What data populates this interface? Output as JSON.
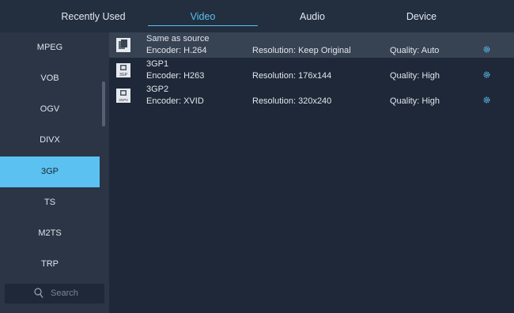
{
  "tabs": [
    {
      "label": "Recently Used",
      "active": false
    },
    {
      "label": "Video",
      "active": true
    },
    {
      "label": "Audio",
      "active": false
    },
    {
      "label": "Device",
      "active": false
    }
  ],
  "sidebar": {
    "items": [
      {
        "label": "MPEG",
        "selected": false
      },
      {
        "label": "VOB",
        "selected": false
      },
      {
        "label": "OGV",
        "selected": false
      },
      {
        "label": "DIVX",
        "selected": false
      },
      {
        "label": "3GP",
        "selected": true
      },
      {
        "label": "TS",
        "selected": false
      },
      {
        "label": "M2TS",
        "selected": false
      },
      {
        "label": "TRP",
        "selected": false
      }
    ],
    "search_placeholder": "Search"
  },
  "presets": [
    {
      "name": "Same as source",
      "encoder": "Encoder: H.264",
      "resolution": "Resolution: Keep Original",
      "quality": "Quality: Auto",
      "icon": "copy-source-icon",
      "thumb_label": ""
    },
    {
      "name": "3GP1",
      "encoder": "Encoder: H263",
      "resolution": "Resolution: 176x144",
      "quality": "Quality: High",
      "icon": "3gp-file-icon",
      "thumb_label": "3GP"
    },
    {
      "name": "3GP2",
      "encoder": "Encoder: XVID",
      "resolution": "Resolution: 320x240",
      "quality": "Quality: High",
      "icon": "3gp-file-icon",
      "thumb_label": "3GP2"
    }
  ],
  "colors": {
    "accent": "#59c2f2",
    "selected_bg": "#5bc1f0",
    "highlight_row": "#374253",
    "sidebar_bg": "#2b3546",
    "list_bg": "#1e2838"
  }
}
